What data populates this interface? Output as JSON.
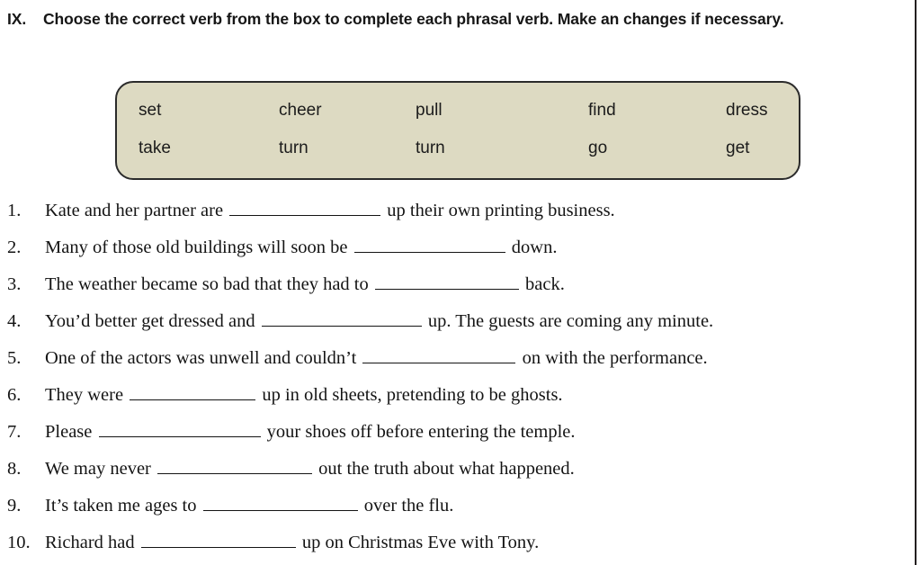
{
  "exercise": {
    "number": "IX.",
    "instruction": "Choose the correct verb from the box to complete each phrasal verb. Make an changes if necessary."
  },
  "word_box": {
    "background_color": "#dddac2",
    "border_color": "#2b2b2b",
    "rows": [
      [
        "set",
        "cheer",
        "pull",
        "find",
        "dress"
      ],
      [
        "take",
        "turn",
        "turn",
        "go",
        "get"
      ]
    ]
  },
  "questions": [
    {
      "number": "1.",
      "before": "Kate and her partner are",
      "blank_width": 168,
      "after": "up their own printing business."
    },
    {
      "number": "2.",
      "before": "Many of those old buildings will soon be",
      "blank_width": 168,
      "after": "down."
    },
    {
      "number": "3.",
      "before": "The weather became so bad that they had to",
      "blank_width": 160,
      "after": "back."
    },
    {
      "number": "4.",
      "before": "You’d better get dressed and",
      "blank_width": 178,
      "after": "up. The guests are coming any minute."
    },
    {
      "number": "5.",
      "before": "One of the actors was unwell and couldn’t",
      "blank_width": 170,
      "after": "on with the performance."
    },
    {
      "number": "6.",
      "before": "They were",
      "blank_width": 140,
      "after": "up in old sheets, pretending to be ghosts."
    },
    {
      "number": "7.",
      "before": "Please",
      "blank_width": 180,
      "after": "your shoes off before entering the temple."
    },
    {
      "number": "8.",
      "before": "We may never",
      "blank_width": 172,
      "after": "out the truth about what happened."
    },
    {
      "number": "9.",
      "before": "It’s taken me ages to",
      "blank_width": 172,
      "after": "over the flu."
    },
    {
      "number": "10.",
      "before": "Richard had",
      "blank_width": 172,
      "after": "up on Christmas Eve with Tony."
    }
  ]
}
